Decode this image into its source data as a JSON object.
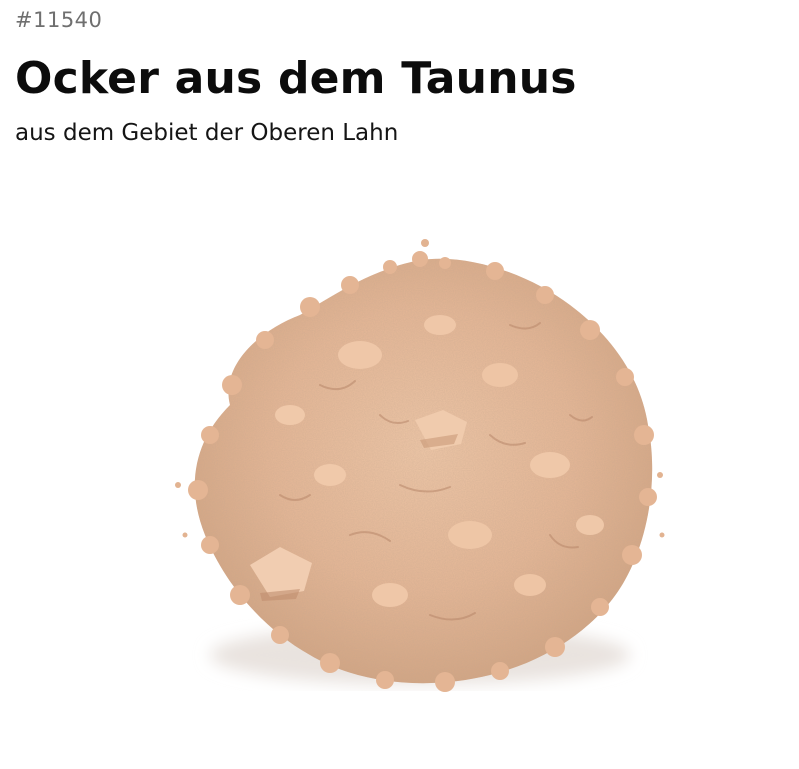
{
  "product": {
    "number": "#11540",
    "title": "Ocker aus dem Taunus",
    "subtitle": "aus dem Gebiet der Oberen Lahn"
  },
  "image": {
    "subject": "pigment-powder-pile",
    "colors": {
      "base": "#e6b796",
      "light": "#f1cdb1",
      "shadow": "#c99a78",
      "deep": "#b8876a"
    }
  }
}
